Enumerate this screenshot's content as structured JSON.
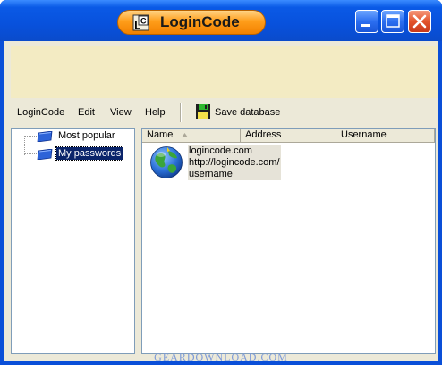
{
  "window": {
    "title": "LoginCode"
  },
  "menu": [
    {
      "label": "LoginCode"
    },
    {
      "label": "Edit"
    },
    {
      "label": "View"
    },
    {
      "label": "Help"
    }
  ],
  "toolbar": {
    "save_label": "Save database",
    "save_icon": "floppy-disk-icon"
  },
  "tree": [
    {
      "label": "Most popular",
      "icon": "folder-icon"
    },
    {
      "label": "My passwords",
      "icon": "folder-icon",
      "selected": true
    }
  ],
  "list": {
    "columns": [
      {
        "label": "Name",
        "sorted": "ascending"
      },
      {
        "label": "Address"
      },
      {
        "label": "Username"
      }
    ],
    "entries": [
      {
        "icon": "globe-icon",
        "name": "logincode.com",
        "address": "http://logincode.com/",
        "username": "username"
      }
    ]
  },
  "watermark": "GEARDOWNLOAD.COM",
  "colors": {
    "titlebar": "#0a5ae6",
    "title_pill": "#ff9e1a",
    "banner": "#f3ebc3",
    "selection": "#0a246a",
    "close_button": "#e3542b"
  }
}
